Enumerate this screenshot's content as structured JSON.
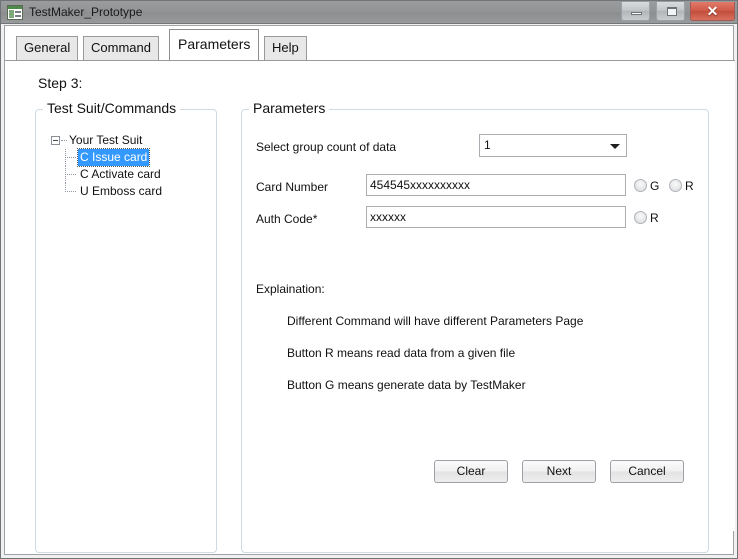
{
  "window": {
    "title": "TestMaker_Prototype",
    "icon": "window-form-icon",
    "controls": {
      "minimize_label": "Minimize",
      "maximize_label": "Maximize",
      "close_label": "✕"
    }
  },
  "tabs": [
    {
      "label": "General",
      "active": false
    },
    {
      "label": "Command",
      "active": false
    },
    {
      "label": "Parameters",
      "active": true
    },
    {
      "label": "Help",
      "active": false
    }
  ],
  "page": {
    "step_label": "Step 3:"
  },
  "testsuit": {
    "group_title": "Test Suit/Commands",
    "root": {
      "label": "Your Test Suit",
      "expanded": true
    },
    "children": [
      {
        "label": "C Issue card",
        "selected": true
      },
      {
        "label": "C Activate card",
        "selected": false
      },
      {
        "label": "U Emboss card",
        "selected": false
      }
    ]
  },
  "parameters": {
    "group_title": "Parameters",
    "group_count": {
      "label": "Select group count of data",
      "value": "1",
      "options": [
        "1"
      ]
    },
    "card_number": {
      "label": "Card Number",
      "value": "454545xxxxxxxxxx",
      "placeholder": "",
      "buttons": [
        {
          "label": "G",
          "selected": false
        },
        {
          "label": "R",
          "selected": false
        }
      ]
    },
    "auth_code": {
      "label": "Auth Code*",
      "value": "xxxxxx",
      "placeholder": "",
      "buttons": [
        {
          "label": "R",
          "selected": false
        }
      ]
    },
    "explanation": {
      "title": "Explaination:",
      "lines": [
        "Different Command will have different Parameters Page",
        "Button R means read data from a given file",
        "Button G means generate data by TestMaker"
      ]
    },
    "actions": [
      {
        "label": "Clear"
      },
      {
        "label": "Next"
      },
      {
        "label": "Cancel"
      }
    ]
  },
  "colors": {
    "selection": "#3399ff",
    "groupbox_border": "#cfdae3",
    "titlebar": "#919395",
    "close_button": "#d25c49"
  }
}
